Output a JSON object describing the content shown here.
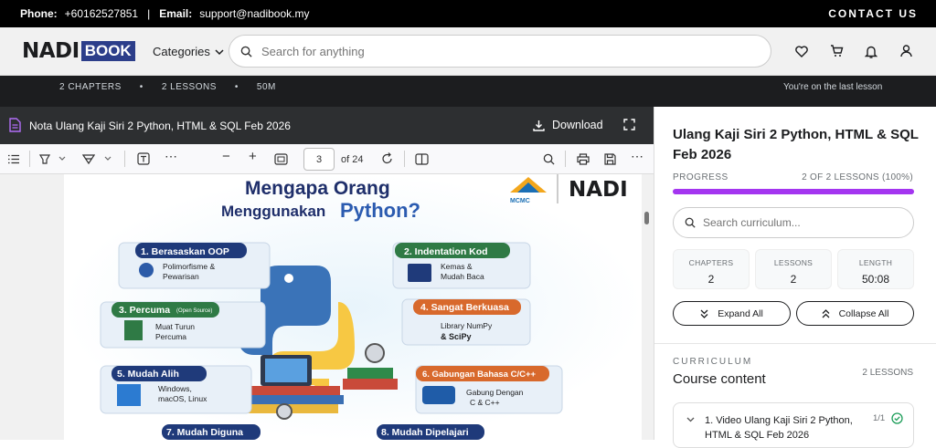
{
  "topbar": {
    "phone_label": "Phone:",
    "phone": "+60162527851",
    "separator": "|",
    "email_label": "Email:",
    "email": "support@nadibook.my",
    "contact": "CONTACT US"
  },
  "header": {
    "logo_nadi": "NADI",
    "logo_book": "BOOK",
    "categories": "Categories",
    "search_placeholder": "Search for anything",
    "icons": [
      "heart-icon",
      "cart-icon",
      "bell-icon",
      "user-icon"
    ]
  },
  "stats_bar": {
    "chapters": "2 CHAPTERS",
    "lessons": "2 LESSONS",
    "duration": "50M",
    "status": "You're on the last lesson"
  },
  "pdf": {
    "title": "Nota Ulang Kaji Siri 2 Python, HTML & SQL Feb 2026",
    "download": "Download",
    "page": "3",
    "of_pages": "of 24"
  },
  "slide": {
    "title_line1": "Mengapa Orang",
    "title_line2": "Menggunakan",
    "title_python": "Python?",
    "logo1": "MCMC",
    "logo2": "NADI",
    "items": [
      {
        "label": "1. Berasaskan OOP",
        "desc1": "Polimorfisme &",
        "desc2": "Pewarisan"
      },
      {
        "label": "2. Indentation Kod",
        "desc1": "Kemas &",
        "desc2": "Mudah Baca"
      },
      {
        "label": "3. Percuma",
        "sub": "(Open Source)",
        "desc1": "Muat Turun",
        "desc2": "Percuma"
      },
      {
        "label": "4. Sangat Berkuasa",
        "desc1": "Library NumPy",
        "desc2": "& SciPy"
      },
      {
        "label": "5. Mudah Alih",
        "desc1": "Windows,",
        "desc2": "macOS, Linux"
      },
      {
        "label": "6. Gabungan Bahasa C/C++",
        "desc1": "Gabung Dengan",
        "desc2": "C & C++"
      },
      {
        "label": "7. Mudah Diguna"
      },
      {
        "label": "8. Mudah Dipelajari"
      }
    ]
  },
  "sidebar": {
    "title": "Ulang Kaji Siri 2 Python, HTML & SQL Feb 2026",
    "progress_label": "PROGRESS",
    "progress_text": "2 OF 2 LESSONS (100%)",
    "progress_value": 1.0,
    "search_placeholder": "Search curriculum...",
    "stats": [
      {
        "label": "CHAPTERS",
        "value": "2"
      },
      {
        "label": "LESSONS",
        "value": "2"
      },
      {
        "label": "LENGTH",
        "value": "50:08"
      }
    ],
    "expand_all": "Expand All",
    "collapse_all": "Collapse All",
    "curriculum_label": "CURRICULUM",
    "curriculum_title": "Course content",
    "curriculum_count": "2 LESSONS",
    "section": {
      "title": "1. Video Ulang Kaji Siri 2 Python, HTML & SQL Feb 2026",
      "count": "1/1"
    }
  },
  "colors": {
    "accent": "#a435f0",
    "dark": "#1c1d1f",
    "brand": "#2c3e8a"
  }
}
